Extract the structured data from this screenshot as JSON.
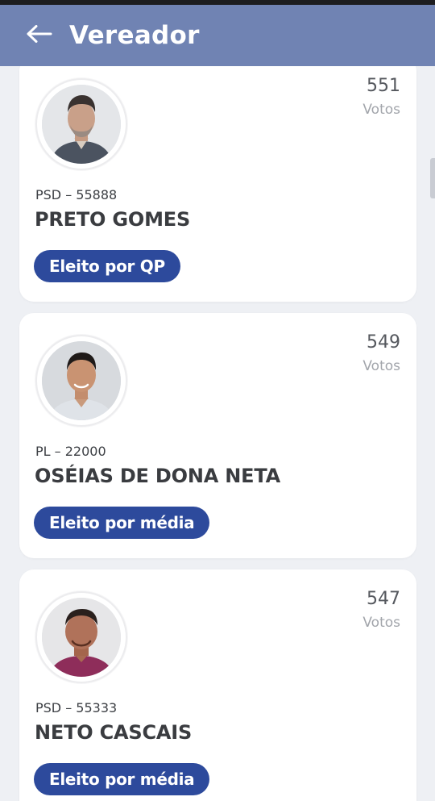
{
  "header": {
    "title": "Vereador",
    "background": "#7083b3",
    "back_icon": "arrow-left-icon"
  },
  "candidates": [
    {
      "votes": "551",
      "votes_label": "Votos",
      "party": "PSD – 55888",
      "name": "PRETO GOMES",
      "status": "Eleito por QP"
    },
    {
      "votes": "549",
      "votes_label": "Votos",
      "party": "PL – 22000",
      "name": "OSÉIAS DE DONA NETA",
      "status": "Eleito por média"
    },
    {
      "votes": "547",
      "votes_label": "Votos",
      "party": "PSD – 55333",
      "name": "NETO CASCAIS",
      "status": "Eleito por média"
    }
  ],
  "colors": {
    "badge": "#2d4a9c",
    "card": "#ffffff",
    "page_background": "#eef0f4"
  }
}
